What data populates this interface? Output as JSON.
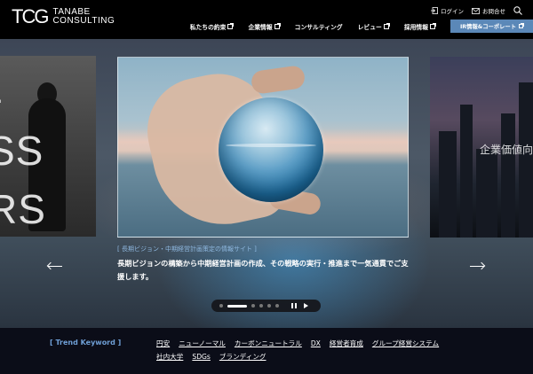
{
  "header": {
    "logo_mark": "TCG",
    "logo_line1": "TANABE",
    "logo_line2": "CONSULTING",
    "util": [
      {
        "label": "ログイン",
        "icon": "login-icon"
      },
      {
        "label": "お問合せ",
        "icon": "mail-icon"
      },
      {
        "label": "",
        "icon": "search-icon"
      }
    ],
    "nav": [
      {
        "label": "私たちの約束",
        "external": true
      },
      {
        "label": "企業情報",
        "external": true
      },
      {
        "label": "コンサルティング",
        "external": false
      },
      {
        "label": "レビュー",
        "external": true
      },
      {
        "label": "採用情報",
        "external": true
      }
    ],
    "ir_button": "IR情報&コーポレート",
    "accent": "#5b88b8"
  },
  "hero": {
    "left_slide_text": [
      "E",
      "SS",
      "RS"
    ],
    "right_slide_caption": "企業価値向",
    "slide_tag": "[ 長期ビジョン・中期経営計画策定の情報サイト ]",
    "slide_desc": "長期ビジョンの構築から中期経営計画の作成、その戦略の実行・推進まで一気通貫でご支援します。",
    "prev_icon": "arrow-left-icon",
    "next_icon": "arrow-right-icon",
    "pager": {
      "count": 6,
      "active": 1
    }
  },
  "keywords": {
    "title": "[ Trend Keyword ]",
    "title_color": "#6f9fd6",
    "items": [
      "円安",
      "ニューノーマル",
      "カーボンニュートラル",
      "DX",
      "経営者育成",
      "グループ経営システム",
      "社内大学",
      "SDGs",
      "ブランディング"
    ]
  }
}
